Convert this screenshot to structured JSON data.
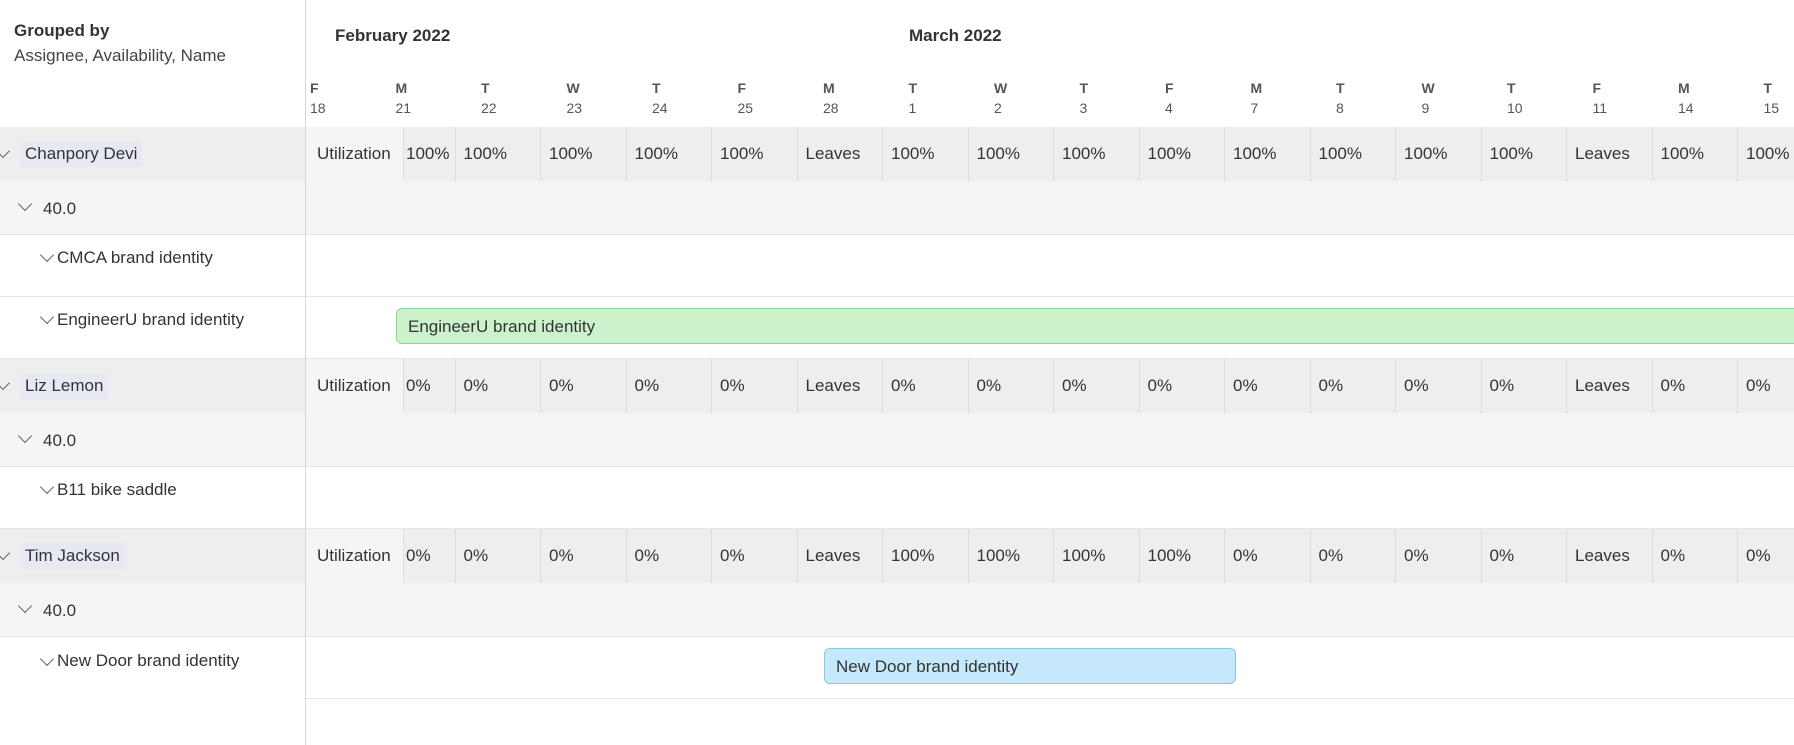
{
  "grouping": {
    "title": "Grouped by",
    "value": "Assignee, Availability, Name"
  },
  "months": [
    {
      "label": "February 2022"
    },
    {
      "label": "March 2022"
    }
  ],
  "days": [
    {
      "dow": "F",
      "num": "18"
    },
    {
      "dow": "M",
      "num": "21"
    },
    {
      "dow": "T",
      "num": "22"
    },
    {
      "dow": "W",
      "num": "23"
    },
    {
      "dow": "T",
      "num": "24"
    },
    {
      "dow": "F",
      "num": "25"
    },
    {
      "dow": "M",
      "num": "28"
    },
    {
      "dow": "T",
      "num": "1"
    },
    {
      "dow": "W",
      "num": "2"
    },
    {
      "dow": "T",
      "num": "3"
    },
    {
      "dow": "F",
      "num": "4"
    },
    {
      "dow": "M",
      "num": "7"
    },
    {
      "dow": "T",
      "num": "8"
    },
    {
      "dow": "W",
      "num": "9"
    },
    {
      "dow": "T",
      "num": "10"
    },
    {
      "dow": "F",
      "num": "11"
    },
    {
      "dow": "M",
      "num": "14"
    },
    {
      "dow": "T",
      "num": "15"
    }
  ],
  "utilization_label": "Utilization",
  "people": [
    {
      "name": "Chanpory Devi",
      "hours": "40.0",
      "utilization": [
        "100%",
        "100%",
        "100%",
        "100%",
        "100%",
        "Leaves",
        "100%",
        "100%",
        "100%",
        "100%",
        "100%",
        "100%",
        "100%",
        "100%",
        "Leaves",
        "100%",
        "100%"
      ],
      "projects": [
        {
          "name": "CMCA brand identity",
          "bar": null
        },
        {
          "name": "EngineerU brand identity",
          "bar": {
            "label": "EngineerU brand identity",
            "color": "green"
          }
        }
      ]
    },
    {
      "name": "Liz Lemon",
      "hours": "40.0",
      "utilization": [
        "0%",
        "0%",
        "0%",
        "0%",
        "0%",
        "Leaves",
        "0%",
        "0%",
        "0%",
        "0%",
        "0%",
        "0%",
        "0%",
        "0%",
        "Leaves",
        "0%",
        "0%"
      ],
      "projects": [
        {
          "name": "B11 bike saddle",
          "bar": null
        }
      ]
    },
    {
      "name": "Tim Jackson",
      "hours": "40.0",
      "utilization": [
        "0%",
        "0%",
        "0%",
        "0%",
        "0%",
        "Leaves",
        "100%",
        "100%",
        "100%",
        "100%",
        "0%",
        "0%",
        "0%",
        "0%",
        "Leaves",
        "0%",
        "0%"
      ],
      "projects": [
        {
          "name": "New Door brand identity",
          "bar": {
            "label": "New Door brand identity",
            "color": "blue"
          }
        }
      ]
    }
  ],
  "colors": {
    "green_bar": "#ccf2cc",
    "blue_bar": "#c5e8fb",
    "person_chip": "#e6e9f2"
  }
}
